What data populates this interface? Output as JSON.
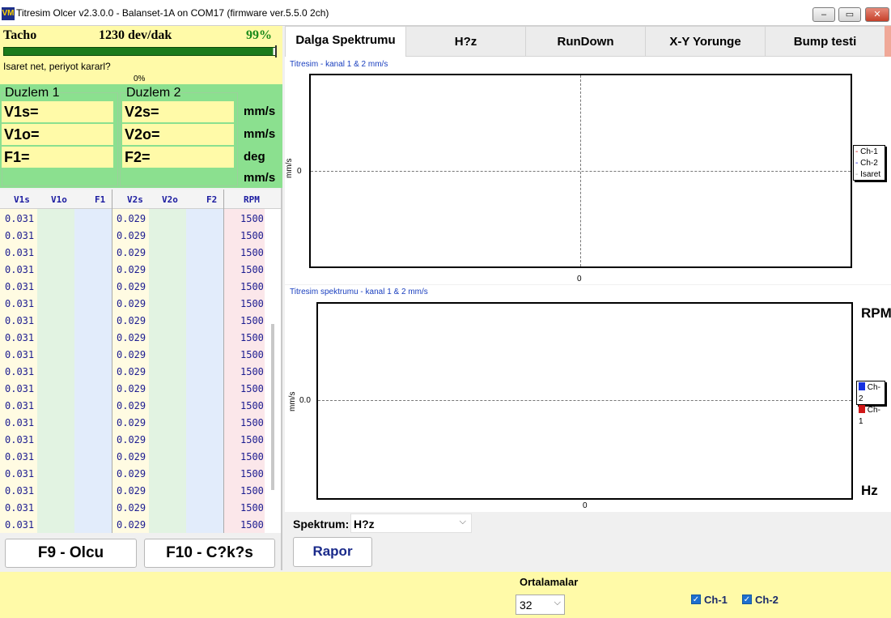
{
  "window": {
    "title": "Titresim Olcer v2.3.0.0 - Balanset-1A on COM17 (firmware ver.5.5.0 2ch)",
    "icon_text": "VM",
    "minimize": "–",
    "maximize": "▭",
    "close": "✕"
  },
  "tacho": {
    "label": "Tacho",
    "rpm": "1230 dev/dak",
    "percent": "99%",
    "status": "Isaret net, periyot kararl?",
    "bar_label": "0%",
    "bar_fill": 0.99
  },
  "planes": {
    "plane1": "Duzlem 1",
    "plane2": "Duzlem 2",
    "p1_fields": [
      "V1s=",
      "V1o=",
      "F1="
    ],
    "p2_fields": [
      "V2s=",
      "V2o=",
      "F2="
    ],
    "units": [
      "mm/s",
      "mm/s",
      "deg",
      "mm/s"
    ]
  },
  "table": {
    "headers": [
      "V1s",
      "V1o",
      "F1",
      "V2s",
      "V2o",
      "F2",
      "RPM"
    ],
    "rows": [
      [
        "0.031",
        "",
        "",
        "0.029",
        "",
        "",
        "1500"
      ],
      [
        "0.031",
        "",
        "",
        "0.029",
        "",
        "",
        "1500"
      ],
      [
        "0.031",
        "",
        "",
        "0.029",
        "",
        "",
        "1500"
      ],
      [
        "0.031",
        "",
        "",
        "0.029",
        "",
        "",
        "1500"
      ],
      [
        "0.031",
        "",
        "",
        "0.029",
        "",
        "",
        "1500"
      ],
      [
        "0.031",
        "",
        "",
        "0.029",
        "",
        "",
        "1500"
      ],
      [
        "0.031",
        "",
        "",
        "0.029",
        "",
        "",
        "1500"
      ],
      [
        "0.031",
        "",
        "",
        "0.029",
        "",
        "",
        "1500"
      ],
      [
        "0.031",
        "",
        "",
        "0.029",
        "",
        "",
        "1500"
      ],
      [
        "0.031",
        "",
        "",
        "0.029",
        "",
        "",
        "1500"
      ],
      [
        "0.031",
        "",
        "",
        "0.029",
        "",
        "",
        "1500"
      ],
      [
        "0.031",
        "",
        "",
        "0.029",
        "",
        "",
        "1500"
      ],
      [
        "0.031",
        "",
        "",
        "0.029",
        "",
        "",
        "1500"
      ],
      [
        "0.031",
        "",
        "",
        "0.029",
        "",
        "",
        "1500"
      ],
      [
        "0.031",
        "",
        "",
        "0.029",
        "",
        "",
        "1500"
      ],
      [
        "0.031",
        "",
        "",
        "0.029",
        "",
        "",
        "1500"
      ],
      [
        "0.031",
        "",
        "",
        "0.029",
        "",
        "",
        "1500"
      ],
      [
        "0.031",
        "",
        "",
        "0.029",
        "",
        "",
        "1500"
      ],
      [
        "0.031",
        "",
        "",
        "0.029",
        "",
        "",
        "1500"
      ]
    ]
  },
  "buttons": {
    "measure": "F9 - Olcu",
    "exit": "F10 - C?k?s",
    "report": "Rapor"
  },
  "tabs": [
    "Dalga Spektrumu",
    "H?z",
    "RunDown",
    "X-Y Yorunge",
    "Bump testi"
  ],
  "chart1": {
    "title": "Titresim  - kanal 1 & 2 mm/s",
    "ylabel": "mm/s",
    "ytick": "0",
    "xtick": "0",
    "legend": [
      "Ch-1",
      "Ch-2",
      "Isaret"
    ],
    "legend_colors": [
      "#d01010",
      "#1010d0",
      "#a0a0a0"
    ]
  },
  "chart2": {
    "title": "Titresim spektrumu  - kanal 1 & 2 mm/s",
    "ylabel": "mm/s",
    "ytick": "0.0",
    "xtick": "0",
    "legend": [
      "Ch-2",
      "Ch-1"
    ],
    "legend_colors": [
      "#1530e0",
      "#d01818"
    ],
    "side_top": "RPM",
    "side_bottom": "Hz"
  },
  "spectrum": {
    "label": "Spektrum:",
    "value": "H?z"
  },
  "averages": {
    "label": "Ortalamalar",
    "value": "32"
  },
  "channels": [
    {
      "label": "Ch-1",
      "checked": true
    },
    {
      "label": "Ch-2",
      "checked": true
    }
  ]
}
